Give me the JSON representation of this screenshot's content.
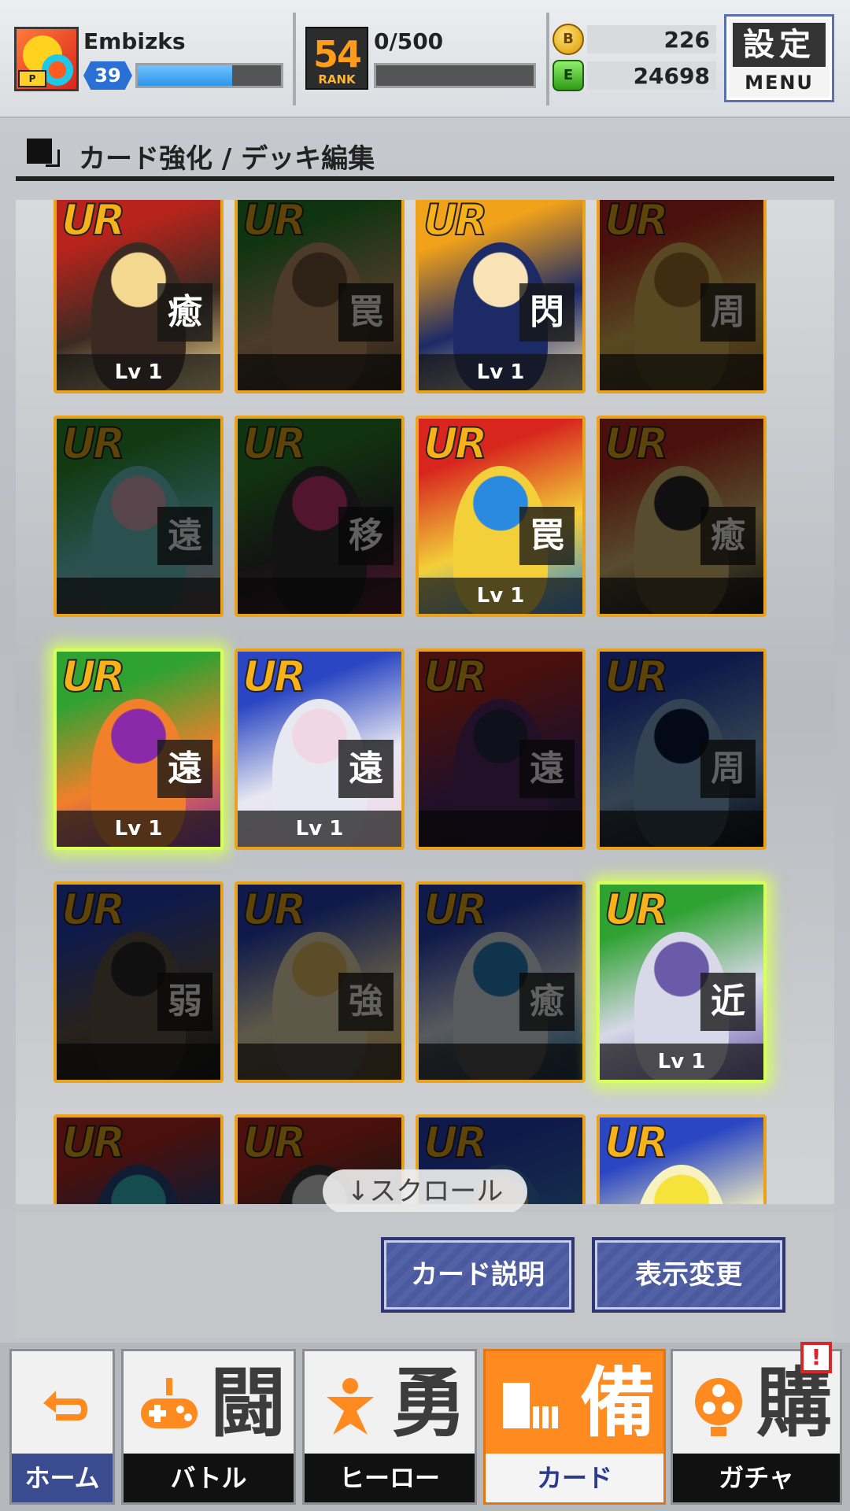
{
  "header": {
    "username": "Embizks",
    "player_level": "39",
    "xp_progress": 0.66,
    "rank_number": "54",
    "rank_label": "RANK",
    "rank_progress_text": "0/500",
    "rank_progress": 0.0,
    "gold_icon_text": "B",
    "gold": "226",
    "green_icon_text": "E",
    "energy": "24698",
    "menu_kanji": "設定",
    "menu_label": "MENU",
    "avatar_tag": "P"
  },
  "page": {
    "title": "カード強化 / デッキ編集"
  },
  "cards": [
    {
      "rarity": "UR",
      "type": "癒",
      "level": "Lv 1",
      "owned": true,
      "glow": false,
      "colors": [
        "#b8241c",
        "#f5d890",
        "#3a2a22"
      ]
    },
    {
      "rarity": "UR",
      "type": "罠",
      "level": "",
      "owned": false,
      "glow": false,
      "colors": [
        "#2f8a2a",
        "#7a5b3a",
        "#c79b6a"
      ]
    },
    {
      "rarity": "UR",
      "type": "閃",
      "level": "Lv 1",
      "owned": true,
      "glow": false,
      "colors": [
        "#f2a21a",
        "#f7e3b5",
        "#1c2a66"
      ]
    },
    {
      "rarity": "UR",
      "type": "周",
      "level": "",
      "owned": false,
      "glow": false,
      "colors": [
        "#c22a1e",
        "#a8742c",
        "#e8c05a"
      ]
    },
    {
      "rarity": "UR",
      "type": "遠",
      "level": "",
      "owned": false,
      "glow": false,
      "colors": [
        "#2f9a32",
        "#e8b6c8",
        "#6fd6d0"
      ]
    },
    {
      "rarity": "UR",
      "type": "移",
      "level": "",
      "owned": false,
      "glow": false,
      "colors": [
        "#2f8a2a",
        "#d63a7a",
        "#333333"
      ]
    },
    {
      "rarity": "UR",
      "type": "罠",
      "level": "Lv 1",
      "owned": true,
      "glow": false,
      "colors": [
        "#d8261e",
        "#2a8ae0",
        "#f3cf3a"
      ]
    },
    {
      "rarity": "UR",
      "type": "癒",
      "level": "",
      "owned": false,
      "glow": false,
      "colors": [
        "#c22a1e",
        "#2a2a2a",
        "#e8c87a"
      ]
    },
    {
      "rarity": "UR",
      "type": "遠",
      "level": "Lv 1",
      "owned": true,
      "glow": true,
      "colors": [
        "#2fa232",
        "#8a2aa8",
        "#f0802a"
      ]
    },
    {
      "rarity": "UR",
      "type": "遠",
      "level": "Lv 1",
      "owned": true,
      "glow": false,
      "colors": [
        "#2a46c2",
        "#f1d6e6",
        "#e8e8f2"
      ]
    },
    {
      "rarity": "UR",
      "type": "遠",
      "level": "",
      "owned": false,
      "glow": false,
      "colors": [
        "#c22a1e",
        "#2a2a4a",
        "#5a2a6a"
      ]
    },
    {
      "rarity": "UR",
      "type": "周",
      "level": "",
      "owned": false,
      "glow": false,
      "colors": [
        "#2a46c2",
        "#0a1a3a",
        "#8ab0d8"
      ]
    },
    {
      "rarity": "UR",
      "type": "弱",
      "level": "",
      "owned": false,
      "glow": false,
      "colors": [
        "#2a46c2",
        "#2a2a2a",
        "#6a5a4a"
      ]
    },
    {
      "rarity": "UR",
      "type": "強",
      "level": "",
      "owned": false,
      "glow": false,
      "colors": [
        "#2a46c2",
        "#f3c86a",
        "#f7e8c0"
      ]
    },
    {
      "rarity": "UR",
      "type": "癒",
      "level": "",
      "owned": false,
      "glow": false,
      "colors": [
        "#2a46c2",
        "#2a8ac8",
        "#e8eef5"
      ]
    },
    {
      "rarity": "UR",
      "type": "近",
      "level": "Lv 1",
      "owned": true,
      "glow": true,
      "colors": [
        "#2fa232",
        "#6a5aa8",
        "#d8d8e8"
      ]
    },
    {
      "rarity": "UR",
      "type": "",
      "level": "",
      "owned": false,
      "glow": false,
      "colors": [
        "#c22a1e",
        "#3ac8d0",
        "#2a4a8a"
      ]
    },
    {
      "rarity": "UR",
      "type": "",
      "level": "",
      "owned": false,
      "glow": false,
      "colors": [
        "#c22a1e",
        "#e8e8e8",
        "#3a3a3a"
      ]
    },
    {
      "rarity": "UR",
      "type": "",
      "level": "",
      "owned": false,
      "glow": false,
      "colors": [
        "#2a46c2",
        "#e8c08a",
        "#3a7ac8"
      ]
    },
    {
      "rarity": "UR",
      "type": "",
      "level": "",
      "owned": true,
      "glow": false,
      "colors": [
        "#2a46c2",
        "#f5e23a",
        "#f7f2c0"
      ]
    }
  ],
  "scroll_hint": "↓スクロール",
  "actions": {
    "card_info": "カード説明",
    "view_toggle": "表示変更"
  },
  "nav": {
    "home_label": "ホーム",
    "battle_kanji": "闘",
    "battle_label": "バトル",
    "hero_kanji": "勇",
    "hero_label": "ヒーロー",
    "card_kanji": "備",
    "card_label": "カード",
    "gacha_kanji": "購",
    "gacha_label": "ガチャ",
    "gacha_alert": "!"
  }
}
